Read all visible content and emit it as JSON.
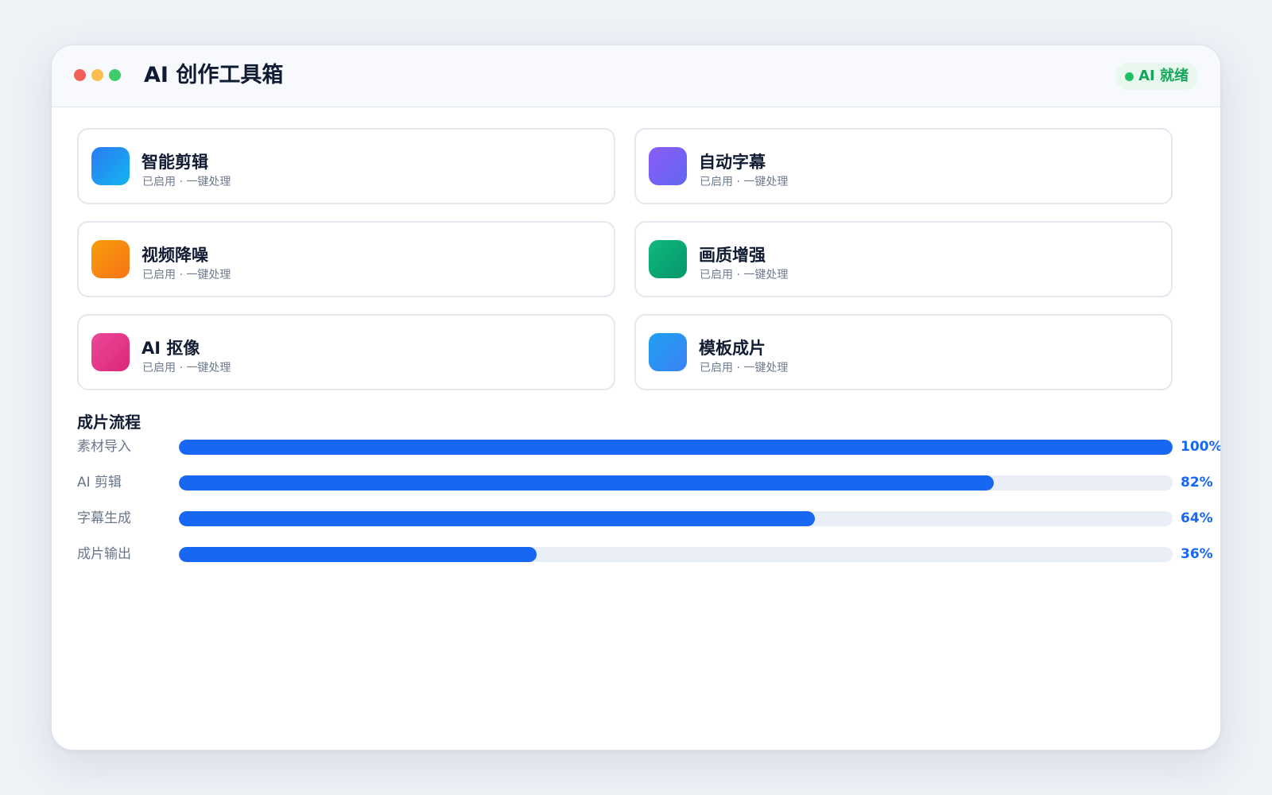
{
  "window": {
    "title": "AI 创作工具箱",
    "controls": [
      {
        "name": "close",
        "color": "#f25f58"
      },
      {
        "name": "minimize",
        "color": "#fbbd4e"
      },
      {
        "name": "maximize",
        "color": "#3ccd6a"
      }
    ],
    "status": {
      "label": "AI 就绪",
      "color": "#16a55a",
      "dot_color": "#1fbf64"
    }
  },
  "tools": [
    {
      "title": "智能剪辑",
      "subtitle": "已启用 · 一键处理",
      "icon": "scissors-icon",
      "gradient": [
        "#2a7bf5",
        "#13b5ee"
      ]
    },
    {
      "title": "自动字幕",
      "subtitle": "已启用 · 一键处理",
      "icon": "subtitle-icon",
      "gradient": [
        "#8b5cf6",
        "#6366f1"
      ]
    },
    {
      "title": "视频降噪",
      "subtitle": "已启用 · 一键处理",
      "icon": "denoise-icon",
      "gradient": [
        "#f59e0b",
        "#f97316"
      ]
    },
    {
      "title": "画质增强",
      "subtitle": "已启用 · 一键处理",
      "icon": "enhance-icon",
      "gradient": [
        "#10b981",
        "#059669"
      ]
    },
    {
      "title": "AI 抠像",
      "subtitle": "已启用 · 一键处理",
      "icon": "cutout-icon",
      "gradient": [
        "#ec4899",
        "#db2777"
      ]
    },
    {
      "title": "模板成片",
      "subtitle": "已启用 · 一键处理",
      "icon": "template-icon",
      "gradient": [
        "#1ea0f0",
        "#3b82f6"
      ]
    }
  ],
  "pipeline": {
    "title": "成片流程",
    "accent": "#1767f2",
    "steps": [
      {
        "label": "素材导入",
        "percent": 100,
        "value_text": "100%"
      },
      {
        "label": "AI 剪辑",
        "percent": 82,
        "value_text": "82%"
      },
      {
        "label": "字幕生成",
        "percent": 64,
        "value_text": "64%"
      },
      {
        "label": "成片输出",
        "percent": 36,
        "value_text": "36%"
      }
    ]
  }
}
